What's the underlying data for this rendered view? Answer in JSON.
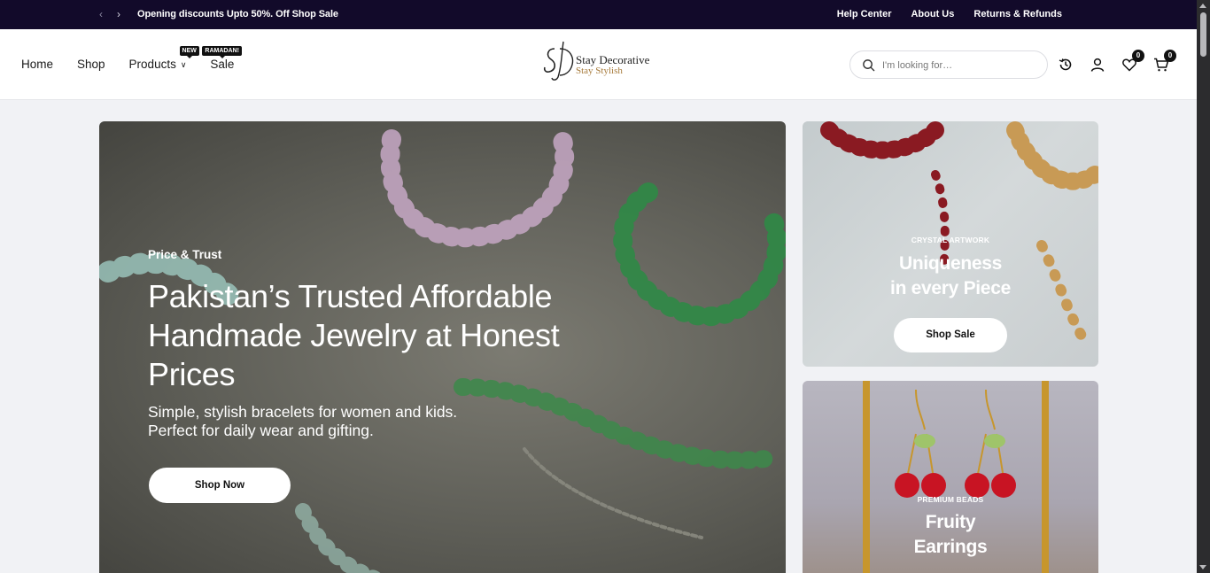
{
  "announcement": {
    "prev_icon": "chevron-left-icon",
    "next_icon": "chevron-right-icon",
    "text": "Opening discounts Upto 50%. Off ",
    "link": "Shop Sale",
    "links": [
      "Help Center",
      "About Us",
      "Returns & Refunds"
    ]
  },
  "nav": {
    "items": [
      {
        "label": "Home"
      },
      {
        "label": "Shop"
      },
      {
        "label": "Products",
        "badge": "NEW"
      },
      {
        "label": "Sale",
        "badge": "RAMADAN!"
      }
    ]
  },
  "logo": {
    "monogram": "SD",
    "name": "Stay Decorative",
    "tagline": "Stay Stylish"
  },
  "search": {
    "placeholder": "I'm looking for…"
  },
  "header_icons": {
    "history": "history-icon",
    "account": "user-icon",
    "wishlist": "heart-icon",
    "wishlist_count": "0",
    "cart": "cart-icon",
    "cart_count": "0"
  },
  "hero": {
    "eyebrow": "Price & Trust",
    "title": "Pakistan’s Trusted Affordable Handmade Jewelry at Honest Prices",
    "description_line1": "Simple, stylish bracelets for women and kids.",
    "description_line2": "Perfect for daily wear and gifting.",
    "button": "Shop Now"
  },
  "promo_cards": [
    {
      "eyebrow": "CRYSTAL ARTWORK",
      "title_line1": "Uniqueness",
      "title_line2": "in every Piece",
      "button": "Shop Sale"
    },
    {
      "eyebrow": "PREMIUM BEADS",
      "title_line1": "Fruity",
      "title_line2": "Earrings"
    }
  ],
  "colors": {
    "topbar": "#120a2a",
    "page_bg": "#f1f2f5",
    "accent_gold": "#a77b3c"
  }
}
